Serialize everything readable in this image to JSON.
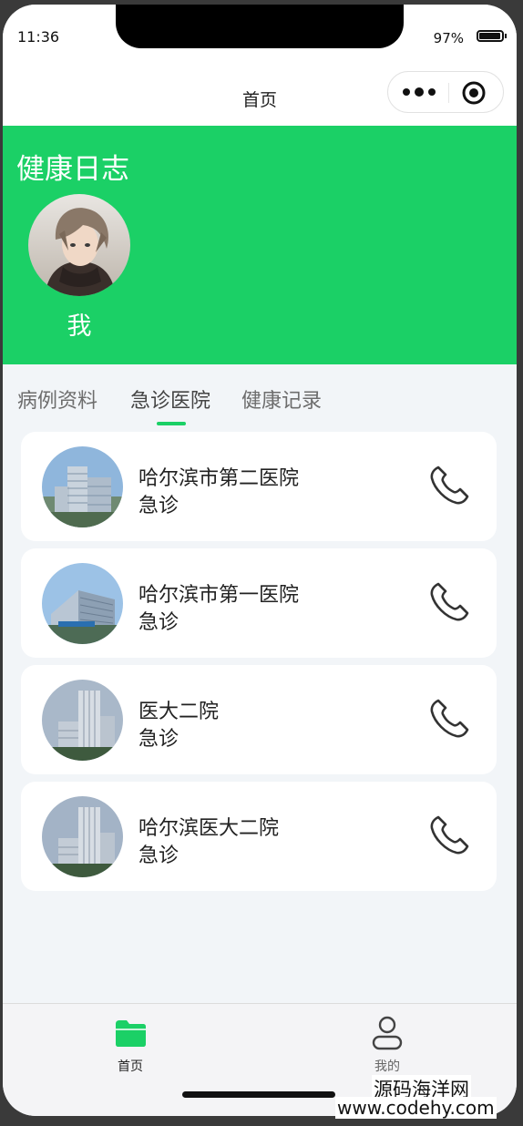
{
  "status_bar": {
    "time": "11:36",
    "battery": "97%"
  },
  "nav": {
    "title": "首页"
  },
  "header": {
    "title": "健康日志",
    "user_name": "我"
  },
  "tabs": [
    {
      "label": "病例资料"
    },
    {
      "label": "急诊医院"
    },
    {
      "label": "健康记录"
    }
  ],
  "active_tab": "急诊医院",
  "hospitals": [
    {
      "name": "哈尔滨市第二医院",
      "type": "急诊"
    },
    {
      "name": "哈尔滨市第一医院",
      "type": "急诊"
    },
    {
      "name": "医大二院",
      "type": "急诊"
    },
    {
      "name": "哈尔滨医大二院",
      "type": "急诊"
    }
  ],
  "tabbar": [
    {
      "label": "首页",
      "icon": "folder-icon",
      "active": true
    },
    {
      "label": "我的",
      "icon": "person-icon",
      "active": false
    }
  ],
  "watermark": {
    "line1": "源码海洋网",
    "line2": "www.codehy.com"
  },
  "colors": {
    "accent": "#1bd066",
    "background": "#f2f5f8",
    "card": "#ffffff",
    "tab_inactive": "#999999"
  }
}
